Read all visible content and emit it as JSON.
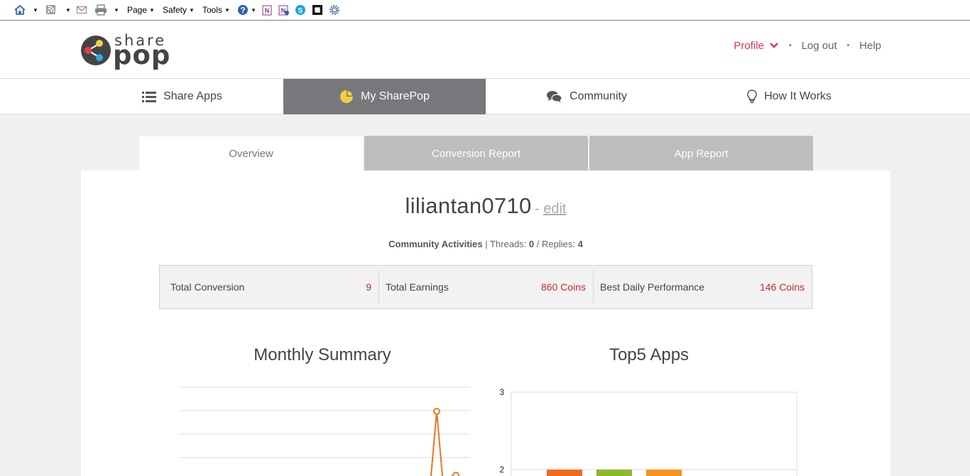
{
  "browser_toolbar": {
    "page_menu": "Page",
    "safety_menu": "Safety",
    "tools_menu": "Tools"
  },
  "header": {
    "logo": {
      "share": "share",
      "pop": "pop"
    },
    "profile_link": "Profile",
    "logout_link": "Log out",
    "help_link": "Help"
  },
  "nav": {
    "items": [
      {
        "label": "Share Apps",
        "icon": "list-icon"
      },
      {
        "label": "My SharePop",
        "icon": "pie-chart-icon",
        "active": true
      },
      {
        "label": "Community",
        "icon": "chat-bubbles-icon"
      },
      {
        "label": "How It Works",
        "icon": "lightbulb-icon"
      }
    ]
  },
  "tabs": [
    {
      "label": "Overview",
      "active": true
    },
    {
      "label": "Conversion Report"
    },
    {
      "label": "App Report"
    }
  ],
  "profile": {
    "username": "liliantan0710",
    "edit_prefix": "- ",
    "edit_label": "edit"
  },
  "community": {
    "title": "Community Activities",
    "threads_label": "Threads:",
    "threads_value": "0",
    "replies_label": "Replies:",
    "replies_value": "4"
  },
  "stats": [
    {
      "label": "Total Conversion",
      "value": "9"
    },
    {
      "label": "Total Earnings",
      "value": "860 Coins"
    },
    {
      "label": "Best Daily Performance",
      "value": "146 Coins"
    }
  ],
  "colors": {
    "accent": "#d9384a",
    "value_red": "#c62c2c",
    "nav_active_bg": "#77787b",
    "line_orange": "#e87722"
  },
  "chart_data": [
    {
      "type": "line",
      "title": "Monthly Summary",
      "note": "partially visible; tick labels not shown",
      "series": [
        {
          "values_visible": [
            "peak near top gridline",
            "second point lower right"
          ]
        }
      ]
    },
    {
      "type": "bar",
      "title": "Top5 Apps",
      "yticks": [
        "3",
        "2"
      ],
      "ylim": [
        0,
        3
      ],
      "bar_values_visible": [
        2,
        2,
        2
      ],
      "bar_colors": [
        "#f26a1b",
        "#8cb82b",
        "#f7931e"
      ]
    }
  ]
}
